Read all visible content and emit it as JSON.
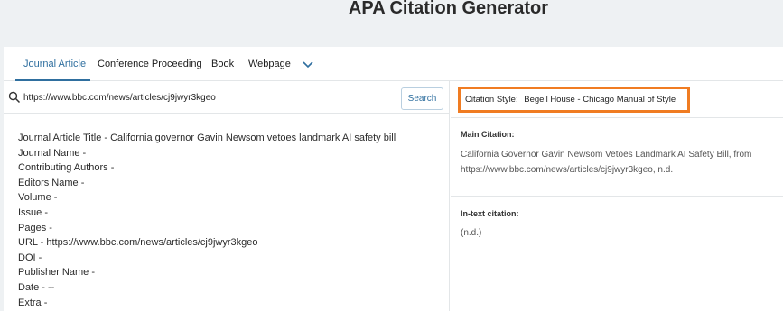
{
  "page": {
    "title": "APA Citation Generator"
  },
  "tabs": [
    {
      "label": "Journal Article",
      "active": true
    },
    {
      "label": "Conference Proceeding",
      "active": false
    },
    {
      "label": "Book",
      "active": false
    },
    {
      "label": "Webpage",
      "active": false
    }
  ],
  "more_tabs_icon": "chevron-down-icon",
  "search": {
    "value": "https://www.bbc.com/news/articles/cj9jwyr3kgeo",
    "button_label": "Search",
    "icon": "search-icon"
  },
  "fields": [
    "Journal Article Title - California governor Gavin Newsom vetoes landmark AI safety bill",
    "Journal Name -",
    "Contributing Authors -",
    "Editors Name -",
    "Volume -",
    "Issue -",
    "Pages -",
    "URL - https://www.bbc.com/news/articles/cj9jwyr3kgeo",
    "DOI -",
    "Publisher Name -",
    "Date - --",
    "Extra -"
  ],
  "citation": {
    "style_label": "Citation Style:",
    "style_value": "Begell House - Chicago Manual of Style",
    "main_label": "Main Citation:",
    "main_text": "California Governor Gavin Newsom Vetoes Landmark AI Safety Bill, from https://www.bbc.com/news/articles/cj9jwyr3kgeo, n.d.",
    "intext_label": "In-text citation:",
    "intext_text": "(n.d.)"
  },
  "colors": {
    "accent": "#2f6f9f",
    "highlight": "#f07c22",
    "background": "#eef1f3"
  }
}
